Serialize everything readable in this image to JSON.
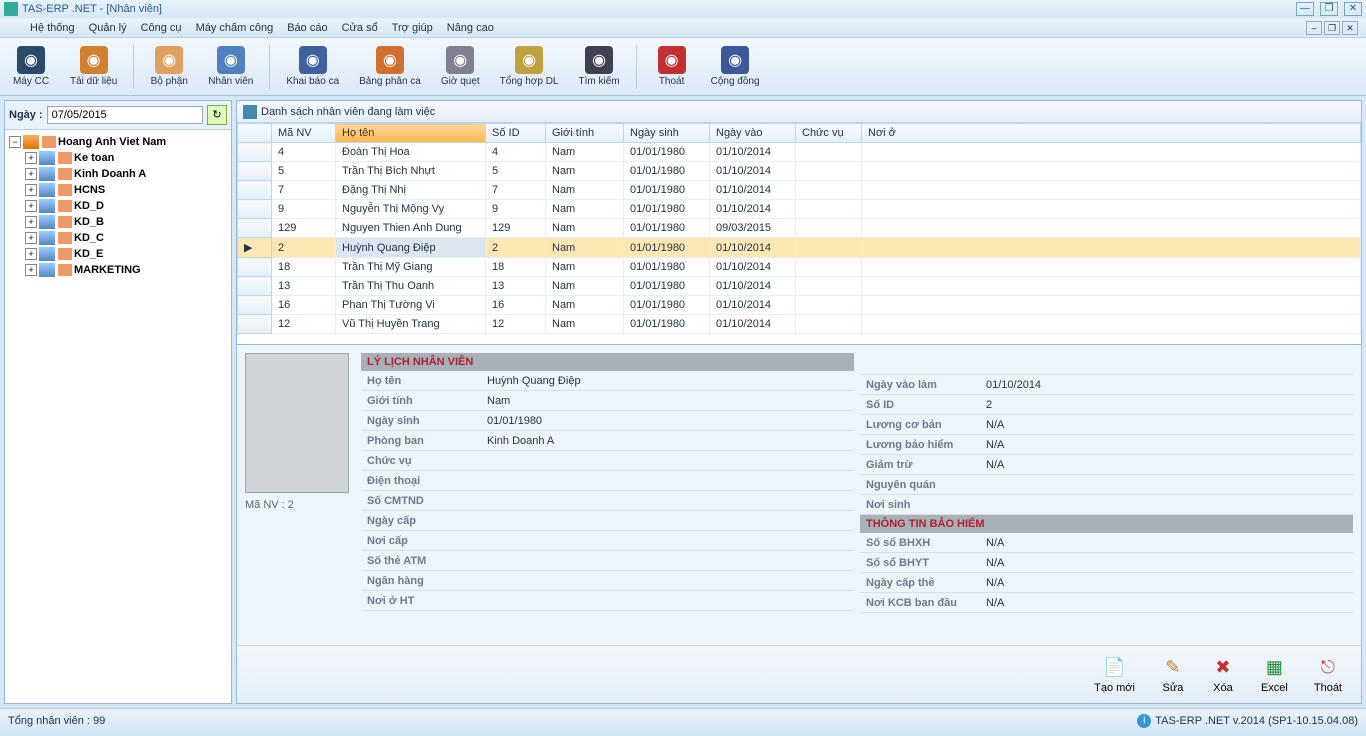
{
  "title": "TAS-ERP .NET - [Nhân viên]",
  "menu": [
    "Hệ thống",
    "Quản lý",
    "Công cụ",
    "Máy chấm công",
    "Báo cáo",
    "Cửa sổ",
    "Trợ giúp",
    "Nâng cao"
  ],
  "toolbar": [
    {
      "label": "Máy CC",
      "color": "#2a4a6a"
    },
    {
      "label": "Tải dữ liệu",
      "color": "#d08030"
    },
    {
      "label": "Bộ phận",
      "color": "#e0a060"
    },
    {
      "label": "Nhân viên",
      "color": "#5080c0"
    },
    {
      "label": "Khai báo ca",
      "color": "#4060a0"
    },
    {
      "label": "Bảng phân ca",
      "color": "#d07030"
    },
    {
      "label": "Giờ quẹt",
      "color": "#808090"
    },
    {
      "label": "Tổng hợp DL",
      "color": "#c0a040"
    },
    {
      "label": "Tìm kiếm",
      "color": "#404050"
    },
    {
      "label": "Thoát",
      "color": "#c03030"
    },
    {
      "label": "Cộng đồng",
      "color": "#3b5998"
    }
  ],
  "date_label": "Ngày :",
  "date_value": "07/05/2015",
  "tree": {
    "root": "Hoang Anh Viet Nam",
    "children": [
      "Ke toan",
      "Kinh Doanh A",
      "HCNS",
      "KD_D",
      "KD_B",
      "KD_C",
      "KD_E",
      "MARKETING"
    ]
  },
  "grid_title": "Danh sách nhân viên đang làm việc",
  "columns": [
    "Mã NV",
    "Họ tên",
    "Số ID",
    "Giới tính",
    "Ngày sinh",
    "Ngày vào",
    "Chức vụ",
    "Nơi ở"
  ],
  "rows": [
    {
      "ma": "4",
      "ten": "Đoàn Thị Hoa",
      "so": "4",
      "gt": "Nam",
      "ns": "01/01/1980",
      "nv": "01/10/2014",
      "cv": "",
      "no": ""
    },
    {
      "ma": "5",
      "ten": "Trần Thị Bích Nhựt",
      "so": "5",
      "gt": "Nam",
      "ns": "01/01/1980",
      "nv": "01/10/2014",
      "cv": "",
      "no": ""
    },
    {
      "ma": "7",
      "ten": "Đặng Thị Nhị",
      "so": "7",
      "gt": "Nam",
      "ns": "01/01/1980",
      "nv": "01/10/2014",
      "cv": "",
      "no": ""
    },
    {
      "ma": "9",
      "ten": "Nguyễn Thị Mộng Vy",
      "so": "9",
      "gt": "Nam",
      "ns": "01/01/1980",
      "nv": "01/10/2014",
      "cv": "",
      "no": ""
    },
    {
      "ma": "129",
      "ten": "Nguyen Thien Anh Dung",
      "so": "129",
      "gt": "Nam",
      "ns": "01/01/1980",
      "nv": "09/03/2015",
      "cv": "",
      "no": ""
    },
    {
      "ma": "2",
      "ten": "Huỳnh Quang Điệp",
      "so": "2",
      "gt": "Nam",
      "ns": "01/01/1980",
      "nv": "01/10/2014",
      "cv": "",
      "no": "",
      "selected": true
    },
    {
      "ma": "18",
      "ten": "Trần Thị Mỹ Giang",
      "so": "18",
      "gt": "Nam",
      "ns": "01/01/1980",
      "nv": "01/10/2014",
      "cv": "",
      "no": ""
    },
    {
      "ma": "13",
      "ten": "Trần Thị Thu Oanh",
      "so": "13",
      "gt": "Nam",
      "ns": "01/01/1980",
      "nv": "01/10/2014",
      "cv": "",
      "no": ""
    },
    {
      "ma": "16",
      "ten": "Phan Thị Tường Vi",
      "so": "16",
      "gt": "Nam",
      "ns": "01/01/1980",
      "nv": "01/10/2014",
      "cv": "",
      "no": ""
    },
    {
      "ma": "12",
      "ten": "Vũ Thị Huyền Trang",
      "so": "12",
      "gt": "Nam",
      "ns": "01/01/1980",
      "nv": "01/10/2014",
      "cv": "",
      "no": ""
    }
  ],
  "detail": {
    "ma_nv_label": "Mã NV :",
    "ma_nv": "2",
    "header1": "LÝ LỊCH NHÂN VIÊN",
    "header2": "THÔNG TIN BẢO HIỂM",
    "left": [
      {
        "k": "Họ tên",
        "v": "Huỳnh Quang Điệp"
      },
      {
        "k": "Giới tính",
        "v": "Nam"
      },
      {
        "k": "Ngày sinh",
        "v": "01/01/1980"
      },
      {
        "k": "Phòng ban",
        "v": "Kinh Doanh A"
      },
      {
        "k": "Chức vụ",
        "v": ""
      },
      {
        "k": "Điện thoại",
        "v": ""
      },
      {
        "k": "Số CMTND",
        "v": ""
      },
      {
        "k": "Ngày cấp",
        "v": ""
      },
      {
        "k": "Nơi cấp",
        "v": ""
      },
      {
        "k": "Số thẻ ATM",
        "v": ""
      },
      {
        "k": "Ngân hàng",
        "v": ""
      },
      {
        "k": "Nơi ở HT",
        "v": ""
      }
    ],
    "right_top": [
      {
        "k": "Ngày vào làm",
        "v": "01/10/2014"
      },
      {
        "k": "Số ID",
        "v": "2"
      },
      {
        "k": "Lương cơ bản",
        "v": "N/A"
      },
      {
        "k": "Lương bảo hiểm",
        "v": "N/A"
      },
      {
        "k": "Giảm trừ",
        "v": "N/A"
      },
      {
        "k": "Nguyên quán",
        "v": ""
      },
      {
        "k": "Nơi sinh",
        "v": ""
      }
    ],
    "right_bottom": [
      {
        "k": "Số sổ BHXH",
        "v": "N/A"
      },
      {
        "k": "Số sổ BHYT",
        "v": "N/A"
      },
      {
        "k": "Ngày cấp thẻ",
        "v": "N/A"
      },
      {
        "k": "Nơi KCB ban đầu",
        "v": "N/A"
      }
    ]
  },
  "actions": [
    {
      "label": "Tạo mới",
      "glyph": "📄",
      "color": "#567"
    },
    {
      "label": "Sửa",
      "glyph": "✎",
      "color": "#c08030"
    },
    {
      "label": "Xóa",
      "glyph": "✖",
      "color": "#c03030"
    },
    {
      "label": "Excel",
      "glyph": "▦",
      "color": "#2a8a3a"
    },
    {
      "label": "Thoát",
      "glyph": "⎋",
      "color": "#c05050"
    }
  ],
  "status_left": "Tổng nhân viên : 99",
  "status_right": "TAS-ERP .NET v.2014 (SP1-10.15.04.08)"
}
